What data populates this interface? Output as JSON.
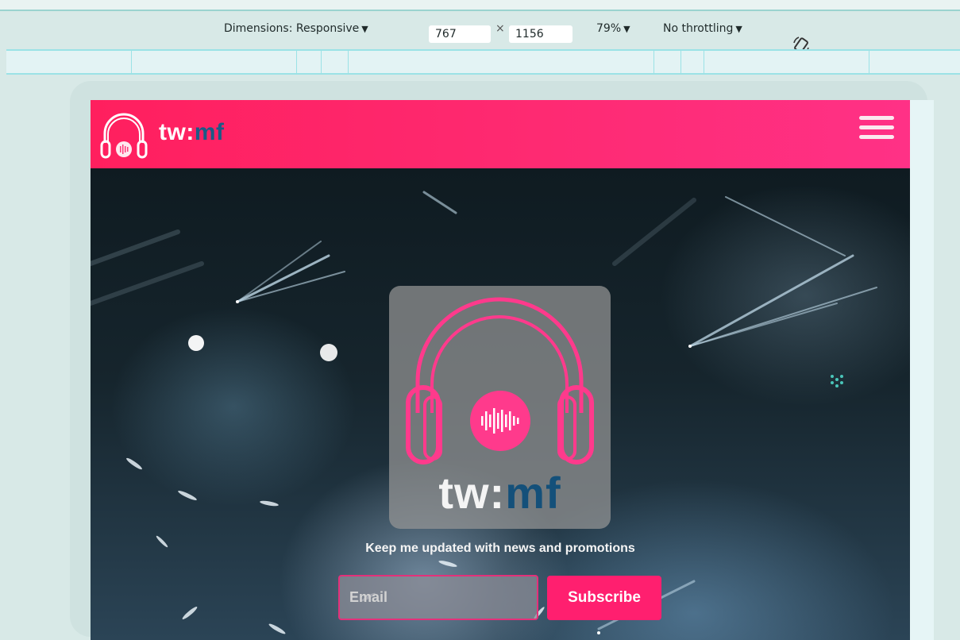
{
  "devtools": {
    "dimensions_label": "Dimensions: Responsive",
    "width_value": "767",
    "times": "×",
    "height_value": "1156",
    "zoom_label": "79%",
    "throttling_label": "No throttling",
    "rotate_icon": "rotate-device-icon"
  },
  "site": {
    "brand_part_a": "tw:",
    "brand_part_b": "mf",
    "menu_icon": "hamburger-menu-icon",
    "logo_icon": "headphones-logo-icon",
    "promo_text": "Keep me updated with news and promotions",
    "email_placeholder": "Email",
    "subscribe_label": "Subscribe"
  },
  "colors": {
    "header_pink": "#ff1f5e",
    "accent_pink": "#ff1f6f",
    "brand_blue": "#1b5b86"
  }
}
